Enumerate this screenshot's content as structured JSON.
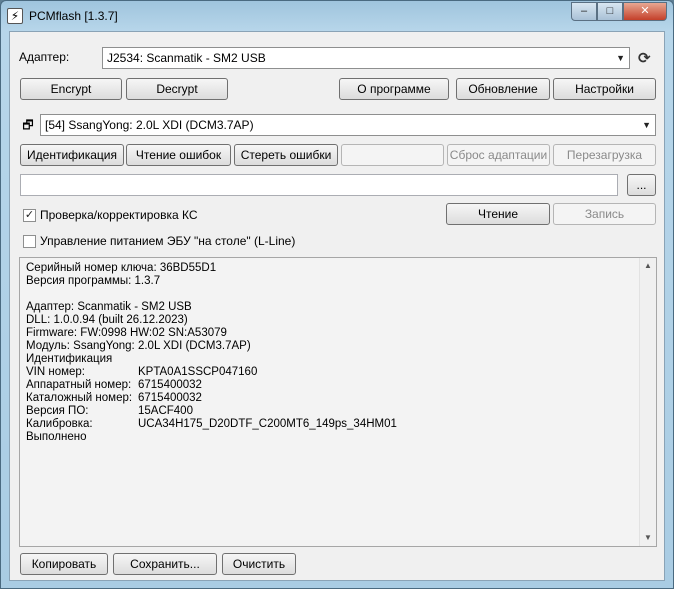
{
  "window": {
    "title": "PCMflash [1.3.7]",
    "icon": "lightning-icon",
    "controls": {
      "minimize": "–",
      "maximize": "□",
      "close": "✕"
    }
  },
  "adapter": {
    "label": "Адаптер:",
    "selected": "J2534: Scanmatik - SM2 USB"
  },
  "top_buttons": {
    "encrypt": "Encrypt",
    "decrypt": "Decrypt",
    "about": "О программе",
    "update": "Обновление",
    "settings": "Настройки"
  },
  "module": {
    "selected": "[54] SsangYong: 2.0L XDI (DCM3.7AP)"
  },
  "action_buttons": {
    "identify": "Идентификация",
    "read_errors": "Чтение ошибок",
    "clear_errors": "Стереть ошибки",
    "reset_adapt": "Сброс адаптации",
    "reboot": "Перезагрузка"
  },
  "file": {
    "path": "",
    "browse": "..."
  },
  "checks": {
    "checksum": {
      "label": "Проверка/корректировка КС",
      "checked": true
    },
    "bench_power": {
      "label": "Управление питанием ЭБУ \"на столе\" (L-Line)",
      "checked": false
    }
  },
  "rw_buttons": {
    "read": "Чтение",
    "write": "Запись"
  },
  "log": {
    "lines": [
      {
        "k": "Серийный номер ключа: 36BD55D1",
        "v": ""
      },
      {
        "k": "Версия программы: 1.3.7",
        "v": ""
      },
      {
        "k": "",
        "v": ""
      },
      {
        "k": "Адаптер: Scanmatik - SM2 USB",
        "v": ""
      },
      {
        "k": "DLL: 1.0.0.94 (built 26.12.2023)",
        "v": ""
      },
      {
        "k": "Firmware: FW:0998 HW:02 SN:A53079",
        "v": ""
      },
      {
        "k": "Модуль: SsangYong: 2.0L XDI (DCM3.7AP)",
        "v": ""
      },
      {
        "k": "Идентификация",
        "v": ""
      },
      {
        "k": "VIN номер:",
        "v": "KPTA0A1SSCP047160"
      },
      {
        "k": "Аппаратный номер:",
        "v": "6715400032"
      },
      {
        "k": "Каталожный номер:",
        "v": "6715400032"
      },
      {
        "k": "Версия ПО:",
        "v": "15ACF400"
      },
      {
        "k": "Калибровка:",
        "v": "UCA34H175_D20DTF_C200MT6_149ps_34HM01"
      },
      {
        "k": "Выполнено",
        "v": ""
      }
    ]
  },
  "bottom_buttons": {
    "copy": "Копировать",
    "save": "Сохранить...",
    "clear": "Очистить"
  }
}
